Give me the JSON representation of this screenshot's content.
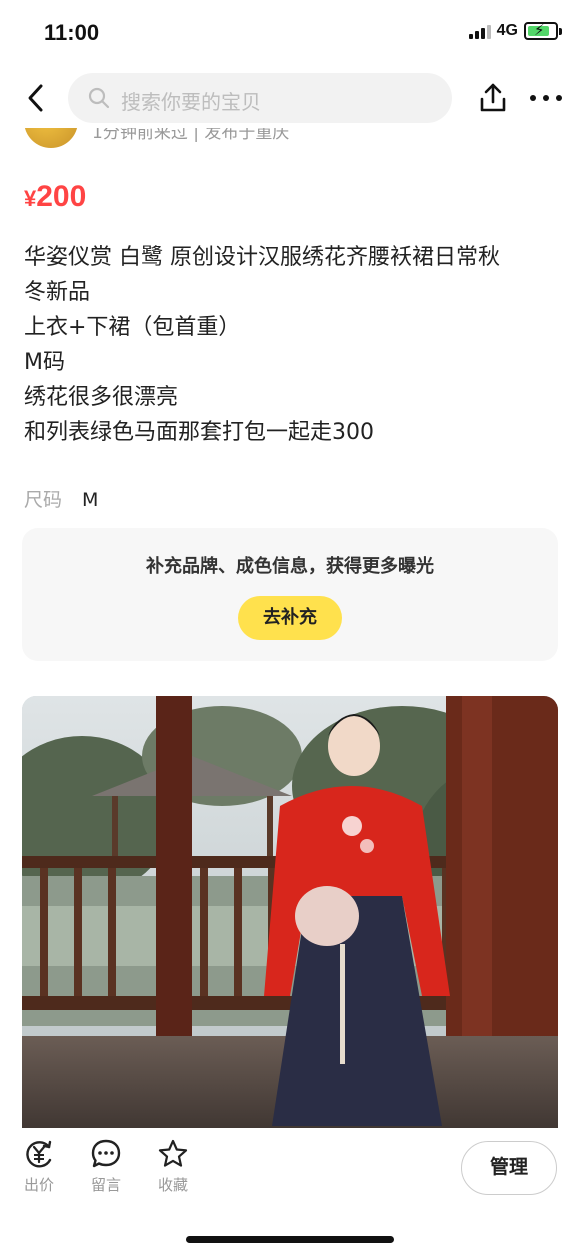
{
  "status_bar": {
    "time": "11:00",
    "network": "4G",
    "battery_level": 0.8,
    "battery_charging": true
  },
  "nav": {
    "search_placeholder": "搜索你要的宝贝",
    "icons": [
      "back-arrow-icon",
      "search-icon",
      "share-icon",
      "more-icon"
    ]
  },
  "seller": {
    "meta": "1分钟前来过 | 发布于重庆"
  },
  "product": {
    "price_symbol": "¥",
    "price_value": "200",
    "description_lines": [
      "华姿仪赏 白鹭 原创设计汉服绣花齐腰袄裙日常秋",
      "冬新品",
      "上衣+下裙（包首重）",
      "M码",
      "绣花很多很漂亮",
      "和列表绿色马面那套打包一起走300"
    ],
    "attribute_label": "尺码",
    "attribute_value": "M"
  },
  "supplement": {
    "text": "补充品牌、成色信息，获得更多曝光",
    "button_label": "去补充"
  },
  "bottom_bar": {
    "offer_label": "出价",
    "message_label": "留言",
    "favorite_label": "收藏",
    "manage_label": "管理"
  },
  "colors": {
    "price": "#ff4444",
    "accent_button": "#ffe14d",
    "card_background": "#f7f7f7"
  }
}
